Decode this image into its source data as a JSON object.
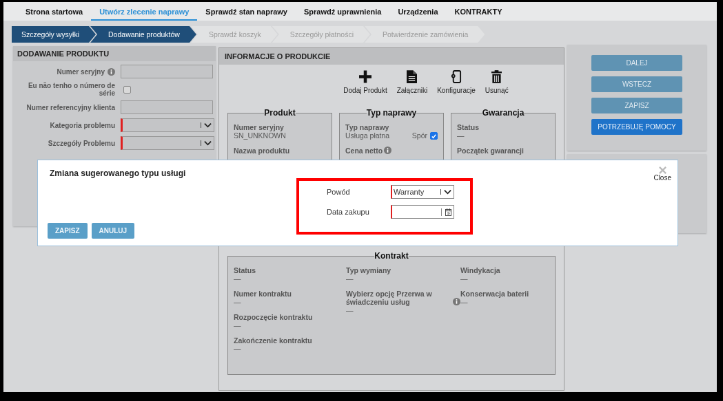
{
  "nav": {
    "tabs": [
      {
        "label": "Strona startowa",
        "selected": false
      },
      {
        "label": "Utwórz zlecenie naprawy",
        "selected": true
      },
      {
        "label": "Sprawdź stan naprawy",
        "selected": false
      },
      {
        "label": "Sprawdź uprawnienia",
        "selected": false
      },
      {
        "label": "Urządzenia",
        "selected": false
      },
      {
        "label": "KONTRAKTY",
        "selected": false
      }
    ]
  },
  "steps": [
    {
      "label": "Szczegóły wysyłki",
      "reached": true
    },
    {
      "label": "Dodawanie produktów",
      "reached": true
    },
    {
      "label": "Sprawdź koszyk",
      "reached": false
    },
    {
      "label": "Szczegóły płatności",
      "reached": false
    },
    {
      "label": "Potwierdzenie zamówienia",
      "reached": false
    }
  ],
  "add_product": {
    "title": "DODAWANIE PRODUKTU",
    "fields": [
      {
        "kind": "input",
        "label": "Numer seryjny",
        "info": true,
        "required": false
      },
      {
        "kind": "checkbox",
        "label": "Eu não tenho o número de série",
        "checked": false
      },
      {
        "kind": "input",
        "label": "Numer referencyjny klienta",
        "info": false,
        "required": false
      },
      {
        "kind": "select",
        "label": "Kategoria problemu",
        "info": false,
        "required": true
      },
      {
        "kind": "select",
        "label": "Szczegóły Problemu",
        "info": false,
        "required": true
      }
    ]
  },
  "product_info": {
    "title": "INFORMACJE O PRODUKCIE",
    "actions": [
      {
        "kind": "add",
        "label": "Dodaj Produkt"
      },
      {
        "kind": "file",
        "label": "Załączniki"
      },
      {
        "kind": "config",
        "label": "Konfiguracje"
      },
      {
        "kind": "delete",
        "label": "Usunąć"
      }
    ],
    "sections": [
      {
        "title": "Produkt",
        "fields": [
          {
            "label": "Numer seryjny",
            "value": "SN_UNKNOWN",
            "info": false
          },
          {
            "label": "Nazwa produktu",
            "info": false
          }
        ]
      },
      {
        "title": "Typ naprawy",
        "fields": [
          {
            "label": "Typ naprawy",
            "value": "Usługa płatna",
            "info": false,
            "flag": {
              "label": "Spór",
              "checked": true
            }
          },
          {
            "label": "Cena netto",
            "info": true
          }
        ]
      },
      {
        "title": "Gwarancja",
        "fields": [
          {
            "label": "Status",
            "value": "—",
            "info": false
          },
          {
            "label": "Początek gwarancji",
            "info": false
          }
        ]
      }
    ],
    "contract": {
      "title": "Kontrakt",
      "columns": [
        [
          {
            "label": "Status",
            "value": "—",
            "info": false
          },
          {
            "label": "Numer kontraktu",
            "value": "—",
            "info": false
          },
          {
            "label": "Rozpoczęcie kontraktu",
            "value": "—",
            "info": false
          },
          {
            "label": "Zakończenie kontraktu",
            "value": "—",
            "info": false
          }
        ],
        [
          {
            "label": "Typ wymiany",
            "value": "—",
            "info": false
          },
          {
            "label": "Wybierz opcję Przerwa w świadczeniu usług",
            "value": "—",
            "info": true
          }
        ],
        [
          {
            "label": "Windykacja",
            "value": "—",
            "info": false
          },
          {
            "label": "Konserwacja baterii",
            "value": "—",
            "info": false
          }
        ]
      ]
    }
  },
  "actions_panel": {
    "buttons": [
      {
        "label": "DALEJ",
        "kind": "secondary"
      },
      {
        "label": "WSTECZ",
        "kind": "secondary"
      },
      {
        "label": "ZAPISZ",
        "kind": "secondary"
      },
      {
        "label": "POTRZEBUJĘ POMOCY",
        "kind": "primary"
      }
    ]
  },
  "modal": {
    "title": "Zmiana sugerowanego typu usługi",
    "close_label": "Close",
    "highlighted": true,
    "fields": [
      {
        "kind": "select",
        "label": "Powód",
        "value": "Warranty",
        "required": true
      },
      {
        "kind": "date",
        "label": "Data zakupu",
        "required": true
      }
    ],
    "buttons": [
      "ZAPISZ",
      "ANULUJ"
    ]
  }
}
